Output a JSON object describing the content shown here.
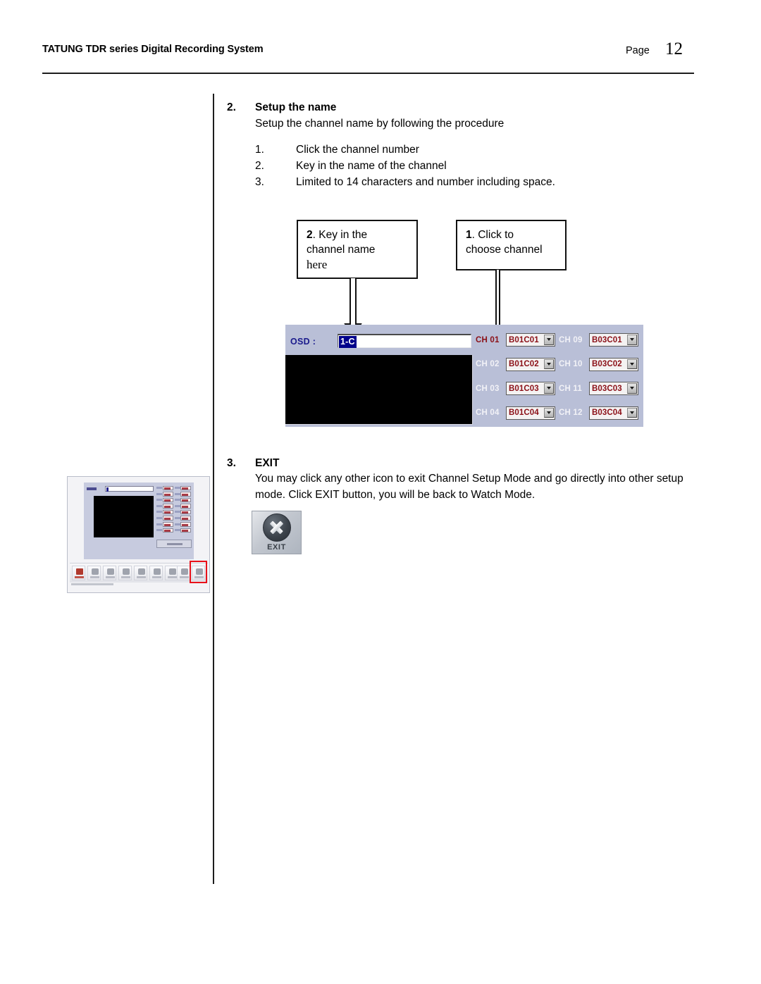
{
  "header": {
    "title": "TATUNG TDR series Digital Recording System",
    "page_label": "Page",
    "page_number": "12"
  },
  "section2": {
    "number": "2.",
    "title": "Setup the name",
    "intro": "Setup the channel name by following the procedure",
    "steps": [
      {
        "num": "1.",
        "text": "Click the channel number"
      },
      {
        "num": "2.",
        "text": "Key in the name of the channel"
      },
      {
        "num": "3.",
        "text": "Limited to 14 characters and number including space."
      }
    ]
  },
  "callouts": {
    "key_in": {
      "number": "2",
      "line1": ". Key in the",
      "line2": "channel name",
      "line3": "here"
    },
    "click": {
      "number": "1",
      "line1": ". Click to",
      "line2": "choose channel"
    }
  },
  "app_panel": {
    "osd_label": "OSD :",
    "osd_value": "1-C",
    "osd_placeholder": "",
    "channels": [
      {
        "label_left": "CH 01",
        "value_left": "B01C01",
        "active_left": true,
        "label_right": "CH 09",
        "value_right": "B03C01",
        "active_right": false
      },
      {
        "label_left": "CH 02",
        "value_left": "B01C02",
        "active_left": false,
        "label_right": "CH 10",
        "value_right": "B03C02",
        "active_right": false
      },
      {
        "label_left": "CH 03",
        "value_left": "B01C03",
        "active_left": false,
        "label_right": "CH 11",
        "value_right": "B03C03",
        "active_right": false
      },
      {
        "label_left": "CH 04",
        "value_left": "B01C04",
        "active_left": false,
        "label_right": "CH 12",
        "value_right": "B03C04",
        "active_right": false
      }
    ],
    "colors": {
      "panel_background": "#b9bfd7",
      "label_inactive": "#f2f2f7",
      "label_active": "#8b0f16",
      "combo_value": "#8b0f16",
      "osd_label": "#1a1a8c",
      "selection_background": "#00008b"
    }
  },
  "section3": {
    "number": "3.",
    "title": "EXIT",
    "body": "You may click any other icon to exit Channel Setup Mode and go directly into other setup mode. Click EXIT button, you will be back to Watch Mode."
  },
  "exit_button": {
    "caption": "EXIT",
    "icon": "close-x-circle-icon"
  },
  "thumbnail": {
    "description": "full-application-window-screenshot",
    "toolbar_icon_count": 9,
    "highlight_color": "#e8111a",
    "channel_row_count": 8
  }
}
